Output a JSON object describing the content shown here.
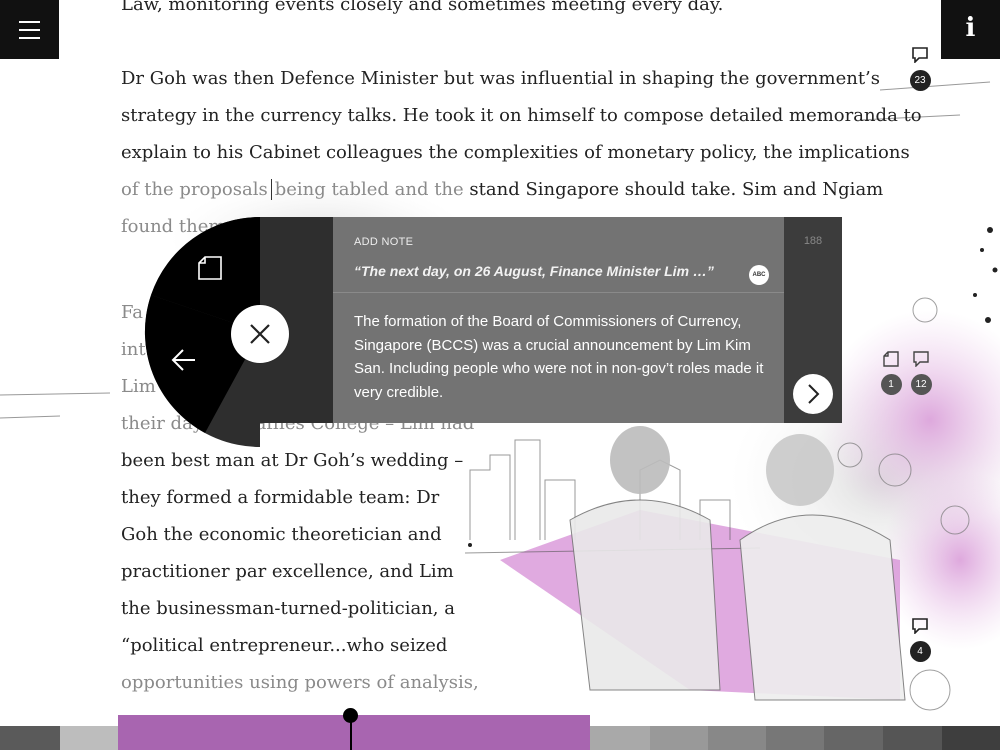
{
  "header": {
    "menu_icon": "hamburger-menu-icon",
    "info_icon": "info-icon",
    "info_label": "i"
  },
  "article": {
    "lines": [
      "Law, monitoring events closely and sometimes meeting every day.",
      "Dr Goh was then Defence Minister but was influential in shaping the government’s",
      "strategy in the currency talks. He took it on himself to compose detailed memoranda to",
      "explain to his Cabinet colleagues the complexities of monetary policy, the implications",
      "of the proposals",
      "being tabled and the",
      "stand Singapore should take. Sim and Ngiam",
      "found them",
      "Fa",
      "int",
      "Lim",
      "their days at Raffles College – Lim had",
      "been best man at Dr Goh’s wedding –",
      "they formed a formidable team: Dr",
      "Goh the economic theoretician and",
      "practitioner par excellence, and Lim",
      "the businessman-turned-politician, a",
      "“political entrepreneur...who seized",
      "opportunities using powers of analysis,"
    ]
  },
  "markers": [
    {
      "icon": "comment-icon",
      "count": "23"
    },
    {
      "icon": "note-icon",
      "count": "1"
    },
    {
      "icon": "comment-icon",
      "count": "12"
    },
    {
      "icon": "comment-icon",
      "count": "4"
    }
  ],
  "radial_menu": {
    "note_icon": "note-icon",
    "back_icon": "back-arrow-icon",
    "close_icon": "close-icon"
  },
  "note": {
    "label": "ADD NOTE",
    "quote": "“The next day, on 26 August, Finance Minister Lim …”",
    "font_badge": "ABC",
    "body": "The formation of the Board of Commissioners of Currency, Singapore (BCCS) was a crucial announcement by Lim Kim San. Including people who were not in non-gov’t roles made it very credible.",
    "char_count": "188",
    "next_icon": "chevron-right-icon"
  },
  "progress": {
    "value": 0.49,
    "fill_color": "#a865b0"
  }
}
